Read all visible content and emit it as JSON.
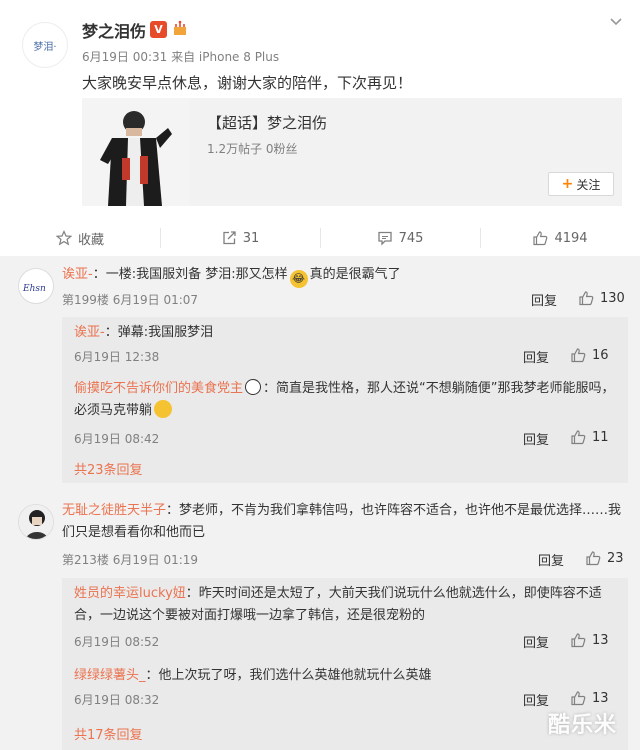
{
  "post": {
    "avatar_text": "梦泪·",
    "author": "梦之泪伤",
    "meta": "6月19日 00:31 来自 iPhone 8 Plus",
    "content": "大家晚安早点休息，谢谢大家的陪伴，下次再见！",
    "card": {
      "title": "【超话】梦之泪伤",
      "subtitle": "1.2万帖子 0粉丝",
      "follow_label": "关注"
    },
    "actions": {
      "favorite": "收藏",
      "repost": "31",
      "comment": "745",
      "like": "4194"
    }
  },
  "comments": [
    {
      "nick": "诶亚-",
      "text": "：一楼:我国服刘备 梦泪:那又怎样",
      "text_after": "真的是很霸气了",
      "meta": "第199楼 6月19日 01:07",
      "reply_label": "回复",
      "likes": "130",
      "replies": [
        {
          "nick": "诶亚-",
          "text": "：弹幕:我国服梦泪",
          "time": "6月19日 12:38",
          "reply_label": "回复",
          "likes": "16"
        },
        {
          "nick": "偷摸吃不告诉你们的美食党主",
          "text": "：简直是我性格，那人还说“不想躺随便”那我梦老师能服吗，",
          "text2": "必须马克带躺",
          "time": "6月19日 08:42",
          "reply_label": "回复",
          "likes": "11"
        }
      ],
      "total_replies": "共23条回复"
    },
    {
      "nick": "无耻之徒胜天半子",
      "text": "：梦老师，不肯为我们拿韩信吗，也许阵容不适合，也许他不是最优选择……我",
      "text2": "们只是想看看你和他而已",
      "meta": "第213楼 6月19日 01:19",
      "reply_label": "回复",
      "likes": "23",
      "replies": [
        {
          "nick": "姓员的幸运lucky妞",
          "text": "：昨天时间还是太短了，大前天我们说玩什么他就选什么，即使阵容不适",
          "text2": "合，一边说这个要被对面打爆哦一边拿了韩信，还是很宠粉的",
          "time": "6月19日 08:52",
          "reply_label": "回复",
          "likes": "13"
        },
        {
          "nick": "绿绿绿薯头_",
          "text": "：他上次玩了呀，我们选什么英雄他就玩什么英雄",
          "time": "6月19日 08:32",
          "reply_label": "回复",
          "likes": "13"
        }
      ],
      "total_replies": "共17条回复"
    }
  ],
  "watermark": "酷乐米",
  "colors": {
    "nick": "#eb7350",
    "accent": "#ff8200",
    "vip": "#e64b2a"
  }
}
